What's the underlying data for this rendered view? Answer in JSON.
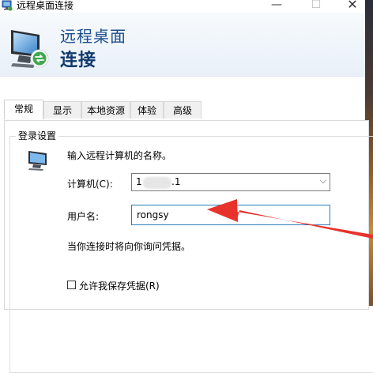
{
  "window": {
    "title": "远程桌面连接",
    "minimize_glyph": "—",
    "maximize_glyph": "☐",
    "close_glyph": "✕"
  },
  "banner": {
    "title": "远程桌面",
    "subtitle": "连接",
    "icon": "remote-desktop-monitor-icon"
  },
  "tabs": [
    {
      "label": "常规",
      "active": true
    },
    {
      "label": "显示",
      "active": false
    },
    {
      "label": "本地资源",
      "active": false
    },
    {
      "label": "体验",
      "active": false
    },
    {
      "label": "高级",
      "active": false
    }
  ],
  "login_settings": {
    "group_label": "登录设置",
    "prompt": "输入远程计算机的名称。",
    "computer_label": "计算机(C):",
    "computer_value_prefix": "1",
    "computer_value_suffix": ".1",
    "computer_arrow": "⌵",
    "username_label": "用户名:",
    "username_value": "rongsy",
    "note": "当你连接时将向你询问凭据。",
    "save_credentials_label": "允许我保存凭据(R)",
    "save_credentials_checked": false
  },
  "colors": {
    "accent_blue": "#1a4d8c",
    "input_focus_border": "#2a7ab8",
    "annotation_arrow": "#e8322c"
  }
}
